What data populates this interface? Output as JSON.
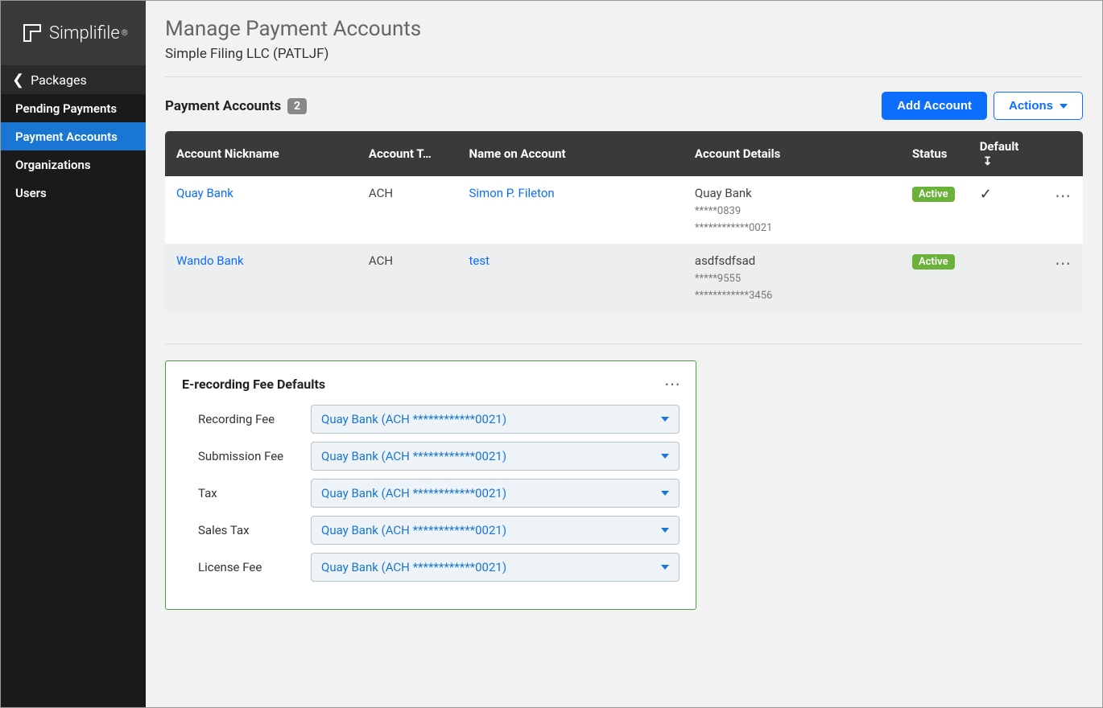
{
  "brand": {
    "name": "Simplifile"
  },
  "sidebar": {
    "back_label": "Packages",
    "items": [
      {
        "label": "Pending Payments"
      },
      {
        "label": "Payment Accounts"
      },
      {
        "label": "Organizations"
      },
      {
        "label": "Users"
      }
    ],
    "active_index": 1
  },
  "page": {
    "title": "Manage Payment Accounts",
    "subtitle": "Simple Filing LLC (PATLJF)"
  },
  "accounts_section": {
    "title": "Payment Accounts",
    "count": "2",
    "add_button": "Add Account",
    "actions_button": "Actions",
    "columns": {
      "nickname": "Account Nickname",
      "type": "Account T…",
      "name": "Name on Account",
      "details": "Account Details",
      "status": "Status",
      "default": "Default"
    },
    "rows": [
      {
        "nickname": "Quay Bank",
        "type": "ACH",
        "name": "Simon P. Fileton",
        "details_main": "Quay Bank",
        "details_sub1": "*****0839",
        "details_sub2": "************0021",
        "status": "Active",
        "is_default": true
      },
      {
        "nickname": "Wando Bank",
        "type": "ACH",
        "name": "test",
        "details_main": "asdfsdfsad",
        "details_sub1": "*****9555",
        "details_sub2": "************3456",
        "status": "Active",
        "is_default": false
      }
    ]
  },
  "fee_defaults": {
    "title": "E-recording Fee Defaults",
    "selected_account": "Quay Bank (ACH ************0021)",
    "fees": [
      {
        "label": "Recording Fee"
      },
      {
        "label": "Submission Fee"
      },
      {
        "label": "Tax"
      },
      {
        "label": "Sales Tax"
      },
      {
        "label": "License Fee"
      }
    ]
  }
}
